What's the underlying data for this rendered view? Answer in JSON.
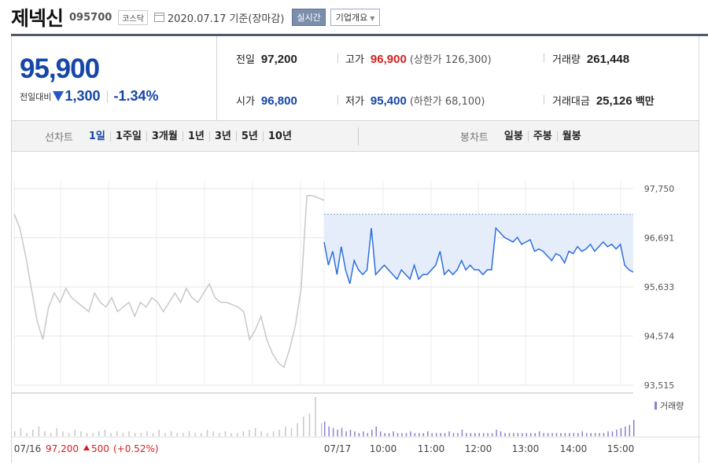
{
  "header": {
    "name": "제넥신",
    "code": "095700",
    "market": "코스닥",
    "date": "2020.07.17 기준(장마감)",
    "realtime_btn": "실시간",
    "overview_btn": "기업개요"
  },
  "summary": {
    "price": "95,900",
    "change_label": "전일대비",
    "change_amount": "1,300",
    "change_pct": "-1.34%",
    "prev_close_label": "전일",
    "prev_close": "97,200",
    "open_label": "시가",
    "open": "96,800",
    "high_label": "고가",
    "high": "96,900",
    "upper_limit": "(상한가 126,300)",
    "low_label": "저가",
    "low": "95,400",
    "lower_limit": "(하한가 68,100)",
    "volume_label": "거래량",
    "volume": "261,448",
    "amount_label": "거래대금",
    "amount": "25,126",
    "amount_unit": "백만"
  },
  "period_bar": {
    "line_title": "선차트",
    "periods": [
      "1일",
      "1주일",
      "3개월",
      "1년",
      "3년",
      "5년",
      "10년"
    ],
    "candle_title": "봉차트",
    "candles": [
      "일봉",
      "주봉",
      "월봉"
    ]
  },
  "chart_data": {
    "type": "line",
    "y_ticks": [
      "97,750",
      "96,691",
      "95,633",
      "94,574",
      "93,515"
    ],
    "ylim": [
      93515,
      97750
    ],
    "x_labels": [
      "07/16",
      "07/17",
      "10:00",
      "11:00",
      "12:00",
      "13:00",
      "14:00",
      "15:00"
    ],
    "reference_price": 97200,
    "prev_footer": {
      "date": "07/16",
      "close": "97,200",
      "change": "500",
      "pct": "(+0.52%)"
    },
    "volume_legend": "거래량",
    "series": [
      {
        "values": [
          97200,
          96900,
          96300,
          95600,
          94900,
          94500,
          95200,
          95500,
          95300,
          95600,
          95400,
          95300,
          95200,
          95100,
          95500,
          95300,
          95200,
          95400,
          95100,
          95200,
          95300,
          95000,
          95300,
          95200,
          95400,
          95300,
          95100,
          95300,
          95500,
          95300,
          95600,
          95400,
          95300,
          95500,
          95700,
          95400,
          95300,
          95300,
          95250,
          95200,
          95100,
          94500,
          94700,
          95000,
          94500,
          94200,
          94000,
          93900,
          94300,
          94800,
          95600,
          97600,
          97600,
          97550,
          97500
        ],
        "colors": {
          "line": "#c8c8c8"
        }
      },
      {
        "values": [
          96600,
          96100,
          96400,
          95900,
          96500,
          96000,
          95700,
          96200,
          96000,
          95900,
          96000,
          96900,
          95900,
          96000,
          96100,
          96000,
          95900,
          95800,
          96000,
          95900,
          95800,
          96100,
          95800,
          95900,
          95900,
          96000,
          96100,
          96400,
          95900,
          96000,
          95900,
          96000,
          96200,
          96000,
          96100,
          96000,
          96000,
          95900,
          96000,
          96000,
          96900,
          96800,
          96700,
          96650,
          96600,
          96700,
          96550,
          96600,
          96650,
          96400,
          96450,
          96400,
          96300,
          96200,
          96350,
          96300,
          96150,
          96400,
          96350,
          96500,
          96400,
          96450,
          96550,
          96400,
          96500,
          96600,
          96500,
          96550,
          96450,
          96550,
          96100,
          96000,
          95950
        ],
        "colors": {
          "line": "#2e6fdc",
          "fill": "#e5edfb"
        }
      }
    ],
    "volume": {
      "prev_day": [
        3,
        5,
        2,
        4,
        6,
        3,
        2,
        5,
        3,
        2,
        4,
        3,
        2,
        2,
        3,
        4,
        2,
        3,
        2,
        3,
        2,
        2,
        3,
        2,
        4,
        2,
        3,
        2,
        2,
        3,
        2,
        2,
        4,
        3,
        2,
        3,
        2,
        2,
        3,
        4,
        5,
        3,
        2,
        3,
        4,
        6,
        5,
        8,
        12,
        14,
        24,
        8
      ],
      "today": [
        9,
        6,
        5,
        4,
        5,
        3,
        4,
        3,
        2,
        3,
        2,
        4,
        6,
        3,
        2,
        2,
        3,
        2,
        2,
        2,
        3,
        2,
        2,
        2,
        3,
        2,
        2,
        2,
        2,
        3,
        2,
        2,
        4,
        2,
        2,
        2,
        2,
        2,
        2,
        2,
        4,
        3,
        2,
        2,
        2,
        2,
        2,
        2,
        2,
        2,
        3,
        2,
        2,
        2,
        2,
        2,
        2,
        2,
        2,
        2,
        3,
        2,
        2,
        2,
        2,
        2,
        3,
        3,
        4,
        5,
        6,
        7,
        10
      ],
      "colors": {
        "prev": "#c8c8c8",
        "today": "#8e7fd0"
      }
    }
  }
}
